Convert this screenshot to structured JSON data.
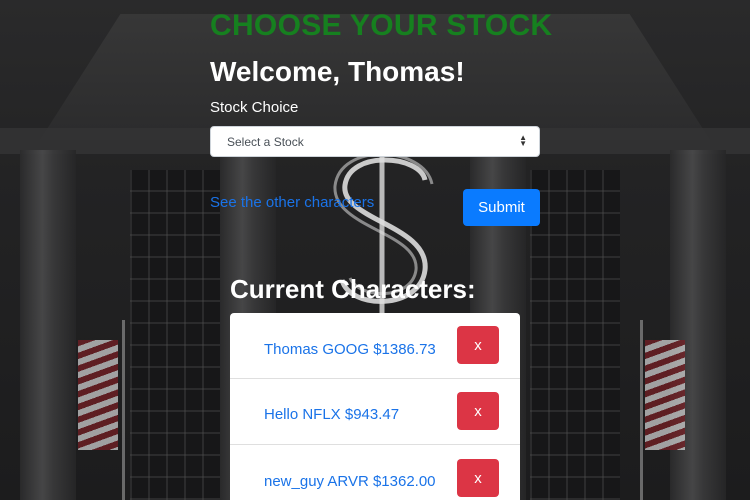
{
  "page": {
    "title": "CHOOSE YOUR STOCK",
    "welcome": "Welcome, Thomas!"
  },
  "form": {
    "label": "Stock Choice",
    "select_value": "Select a Stock",
    "link_text": "See the other characters",
    "submit_label": "Submit"
  },
  "characters": {
    "heading": "Current Characters:",
    "items": [
      {
        "text": "Thomas GOOG $1386.73",
        "delete_label": "x"
      },
      {
        "text": "Hello NFLX $943.47",
        "delete_label": "x"
      },
      {
        "text": "new_guy ARVR $1362.00",
        "delete_label": "x"
      }
    ]
  },
  "colors": {
    "title": "#16801f",
    "link": "#1a73e8",
    "primary_button": "#0a7bff",
    "danger_button": "#dc3545"
  },
  "icons": {
    "select_arrow": "chevron-up-down-icon",
    "background_sign": "dollar-sign-icon"
  }
}
